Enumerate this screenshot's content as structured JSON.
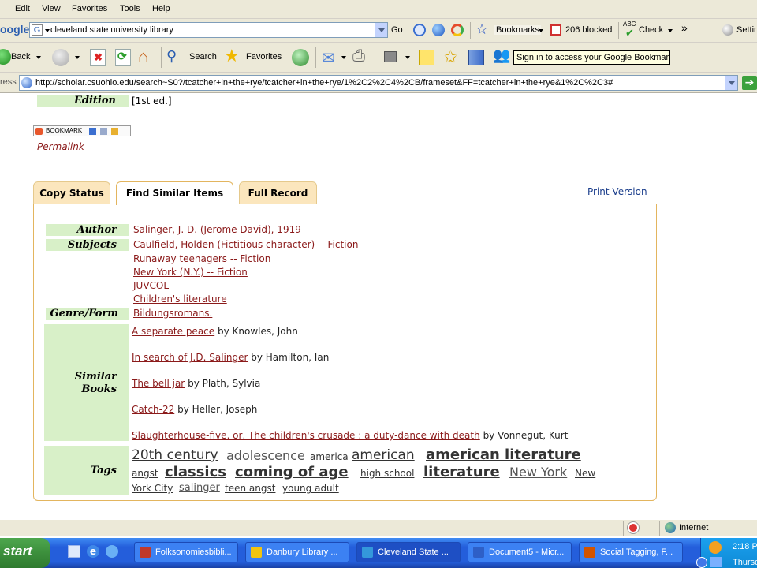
{
  "menu": [
    "Edit",
    "View",
    "Favorites",
    "Tools",
    "Help"
  ],
  "google_toolbar": {
    "logo": "oogle",
    "search_value": "cleveland state university library",
    "go": "Go",
    "bookmarks": "Bookmarks",
    "blocked": "206 blocked",
    "check": "Check",
    "more": "»",
    "settings": "Settin"
  },
  "nav": {
    "back": "Back",
    "search": "Search",
    "favorites": "Favorites",
    "tooltip": "Sign in to access your Google Bookmarks"
  },
  "address": {
    "label": "ress",
    "url": "http://scholar.csuohio.edu/search~S0?/tcatcher+in+the+rye/tcatcher+in+the+rye/1%2C2%2C4%2CB/frameset&FF=tcatcher+in+the+rye&1%2C%2C3#"
  },
  "record": {
    "edition_label": "Edition",
    "edition_value": "[1st ed.]",
    "bookmark_button": "BOOKMARK",
    "permalink": "Permalink"
  },
  "tabs": [
    "Copy Status",
    "Find Similar Items",
    "Full Record"
  ],
  "print_version": "Print Version",
  "similar": {
    "author_label": "Author",
    "author": "Salinger, J. D. (Jerome David), 1919-",
    "subjects_label": "Subjects",
    "subjects": [
      "Caulfield, Holden (Fictitious character) -- Fiction",
      "Runaway teenagers -- Fiction",
      "New York (N.Y.) -- Fiction",
      "JUVCOL",
      "Children's literature"
    ],
    "genre_label": "Genre/Form",
    "genre": "Bildungsromans.",
    "similar_books_label_1": "Similar",
    "similar_books_label_2": "Books",
    "books": [
      {
        "title": "A separate peace",
        "author": "by Knowles, John"
      },
      {
        "title": "In search of J.D. Salinger",
        "author": "by Hamilton, Ian"
      },
      {
        "title": "The bell jar",
        "author": "by Plath, Sylvia"
      },
      {
        "title": "Catch-22",
        "author": "by Heller, Joseph"
      },
      {
        "title": "Slaughterhouse-five, or, The children's crusade : a duty-dance with death",
        "author": "by Vonnegut, Kurt"
      }
    ],
    "tags_label": "Tags",
    "tags": [
      {
        "text": "20th century",
        "weight": 4
      },
      {
        "text": "adolescence",
        "weight": 3
      },
      {
        "text": "america",
        "weight": 1
      },
      {
        "text": "american",
        "weight": 4
      },
      {
        "text": "american literature",
        "weight": 5
      },
      {
        "text": "angst",
        "weight": 1
      },
      {
        "text": "classics",
        "weight": 5
      },
      {
        "text": "coming of age",
        "weight": 5
      },
      {
        "text": "high school",
        "weight": 1
      },
      {
        "text": "literature",
        "weight": 5
      },
      {
        "text": "New York",
        "weight": 3
      },
      {
        "text": "New",
        "weight": 1
      },
      {
        "text": "York City",
        "weight": 1
      },
      {
        "text": "salinger",
        "weight": 2
      },
      {
        "text": "teen angst",
        "weight": 1
      },
      {
        "text": "young adult",
        "weight": 1
      }
    ]
  },
  "status": {
    "zone": "Internet"
  },
  "taskbar": {
    "start": "start",
    "tasks": [
      {
        "label": "Folksonomiesbibli...",
        "color": "#c0392b"
      },
      {
        "label": "Danbury Library ...",
        "color": "#f1c40f"
      },
      {
        "label": "Cleveland State ...",
        "color": "#3498db"
      },
      {
        "label": "Document5 - Micr...",
        "color": "#2e5fc7"
      },
      {
        "label": "Social Tagging, F...",
        "color": "#d35400"
      }
    ],
    "time": "2:18 P",
    "day": "Thursd"
  }
}
